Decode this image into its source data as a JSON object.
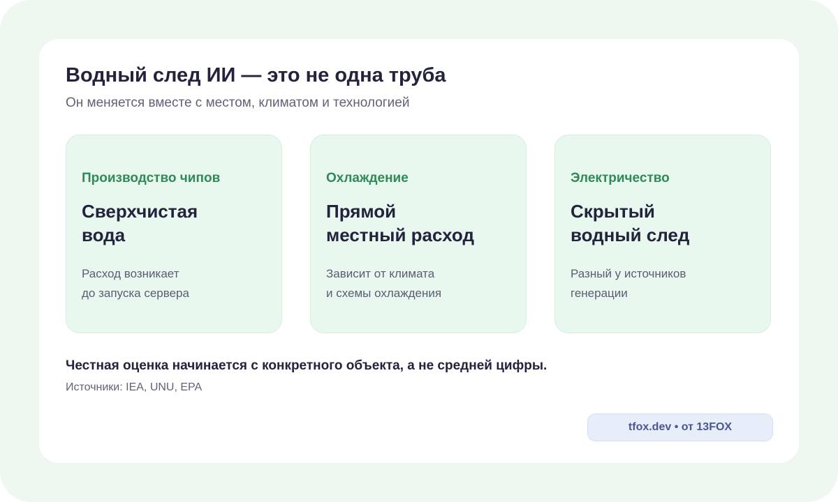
{
  "header": {
    "title": "Водный след ИИ — это не одна труба",
    "subtitle": "Он меняется вместе с местом, климатом и технологией"
  },
  "cards": [
    {
      "kicker": "Производство чипов",
      "heading": [
        "Сверхчистая",
        "вода"
      ],
      "text": [
        "Расход возникает",
        "до запуска сервера"
      ]
    },
    {
      "kicker": "Охлаждение",
      "heading": [
        "Прямой",
        "местный расход"
      ],
      "text": [
        "Зависит от климата",
        "и схемы охлаждения"
      ]
    },
    {
      "kicker": "Электричество",
      "heading": [
        "Скрытый",
        "водный след"
      ],
      "text": [
        "Разный у источников",
        "генерации"
      ]
    }
  ],
  "footer": {
    "conclusion": "Честная оценка начинается с конкретного объекта, а не средней цифры.",
    "sources": "Источники: IEA, UNU, EPA",
    "badge": "tfox.dev • от 13FOX"
  },
  "colors": {
    "frame_background": "#eef8f1",
    "tile_background": "#e9f8ee",
    "accent_green": "#2f8a57",
    "heading_dark": "#24233d",
    "badge_background": "#e7eefa",
    "badge_text": "#4a5793"
  }
}
